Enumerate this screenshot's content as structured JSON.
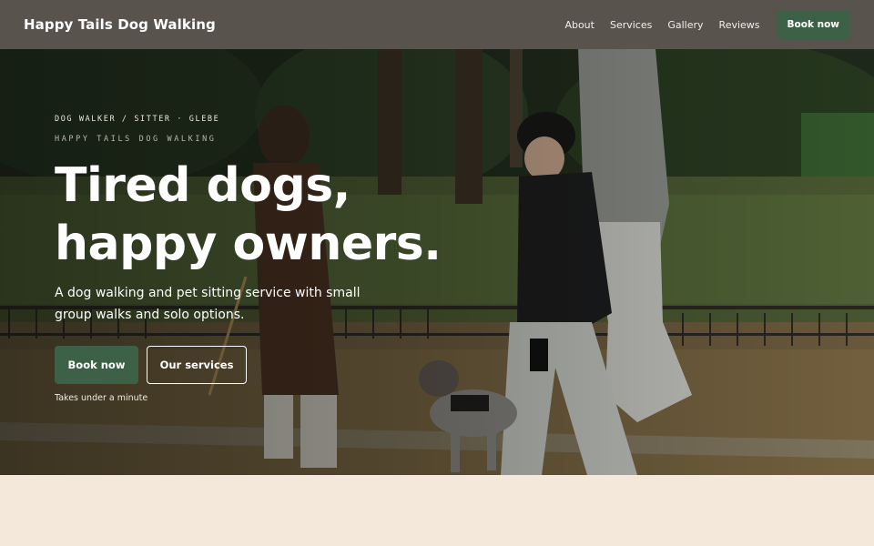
{
  "nav": {
    "brand": "Happy Tails Dog Walking",
    "links": [
      "About",
      "Services",
      "Gallery",
      "Reviews"
    ],
    "cta": "Book now"
  },
  "hero": {
    "eyebrow": "DOG WALKER / SITTER · GLEBE",
    "eyebrow_sub": "HAPPY TAILS DOG WALKING",
    "headline_line1": "Tired dogs,",
    "headline_line2": "happy owners.",
    "subhead": "A dog walking and pet sitting service with small group walks and solo options.",
    "primary_cta": "Book now",
    "secondary_cta": "Our services",
    "helper": "Takes under a minute"
  },
  "colors": {
    "nav_bg": "#59534d",
    "accent_green": "#3c6147",
    "page_bg": "#f3e8d9"
  }
}
